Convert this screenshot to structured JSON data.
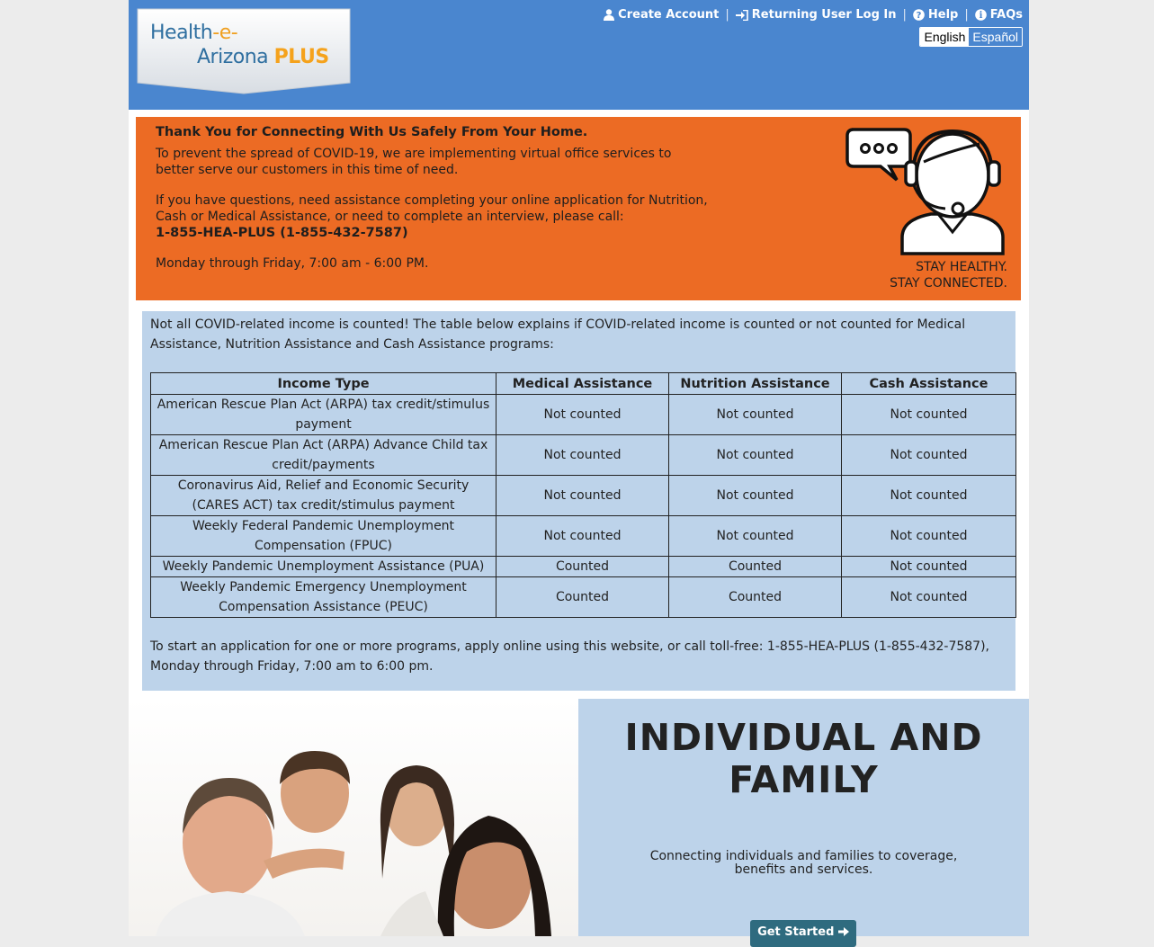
{
  "logo": {
    "health": "Health",
    "dash_e": "-e-",
    "arizona": "Arizona",
    "plus": "PLUS"
  },
  "topnav": {
    "create_account": "Create Account",
    "login": "Returning User Log In",
    "help": "Help",
    "faqs": "FAQs",
    "separator": "|"
  },
  "language": {
    "english": "English",
    "spanish": "Español"
  },
  "banner": {
    "title": "Thank You for Connecting With Us Safely From Your Home.",
    "para1": "To prevent the spread of COVID-19, we are implementing virtual office services to better serve our customers in this time of need.",
    "para2": "If you have questions, need assistance completing your online application for Nutrition, Cash or Medical Assistance, or need to complete an interview, please call:",
    "phone": "1-855-HEA-PLUS (1-855-432-7587)",
    "hours": "Monday through Friday, 7:00 am - 6:00 PM.",
    "stay_healthy": "STAY HEALTHY.",
    "stay_connected": "STAY CONNECTED.",
    "color": "#ec6b24"
  },
  "income": {
    "intro": "Not all COVID-related income is counted! The table below explains if COVID-related income is counted or not counted for Medical Assistance, Nutrition Assistance and Cash Assistance programs:",
    "headers": [
      "Income Type",
      "Medical Assistance",
      "Nutrition Assistance",
      "Cash Assistance"
    ],
    "rows": [
      [
        "American Rescue Plan Act (ARPA) tax credit/stimulus payment",
        "Not counted",
        "Not counted",
        "Not counted"
      ],
      [
        "American Rescue Plan Act (ARPA) Advance Child tax credit/payments",
        "Not counted",
        "Not counted",
        "Not counted"
      ],
      [
        "Coronavirus Aid, Relief and Economic Security (CARES ACT) tax credit/stimulus payment",
        "Not counted",
        "Not counted",
        "Not counted"
      ],
      [
        "Weekly Federal Pandemic Unemployment Compensation (FPUC)",
        "Not counted",
        "Not counted",
        "Not counted"
      ],
      [
        "Weekly Pandemic Unemployment Assistance (PUA)",
        "Counted",
        "Counted",
        "Not counted"
      ],
      [
        "Weekly Pandemic Emergency Unemployment Compensation Assistance (PEUC)",
        "Counted",
        "Counted",
        "Not counted"
      ]
    ],
    "footer": "To start an application for one or more programs, apply online using this website, or call toll-free: 1-855-HEA-PLUS (1-855-432-7587), Monday through Friday, 7:00 am to 6:00 pm."
  },
  "hero": {
    "title_line1": "INDIVIDUAL AND",
    "title_line2": "FAMILY",
    "subtitle": "Connecting individuals and families to coverage, benefits and services.",
    "button": "Get Started"
  },
  "colors": {
    "header_blue": "#4a86cf",
    "light_blue": "#bdd3ea",
    "orange": "#ec6b24",
    "button_teal": "#2f6b7f"
  }
}
